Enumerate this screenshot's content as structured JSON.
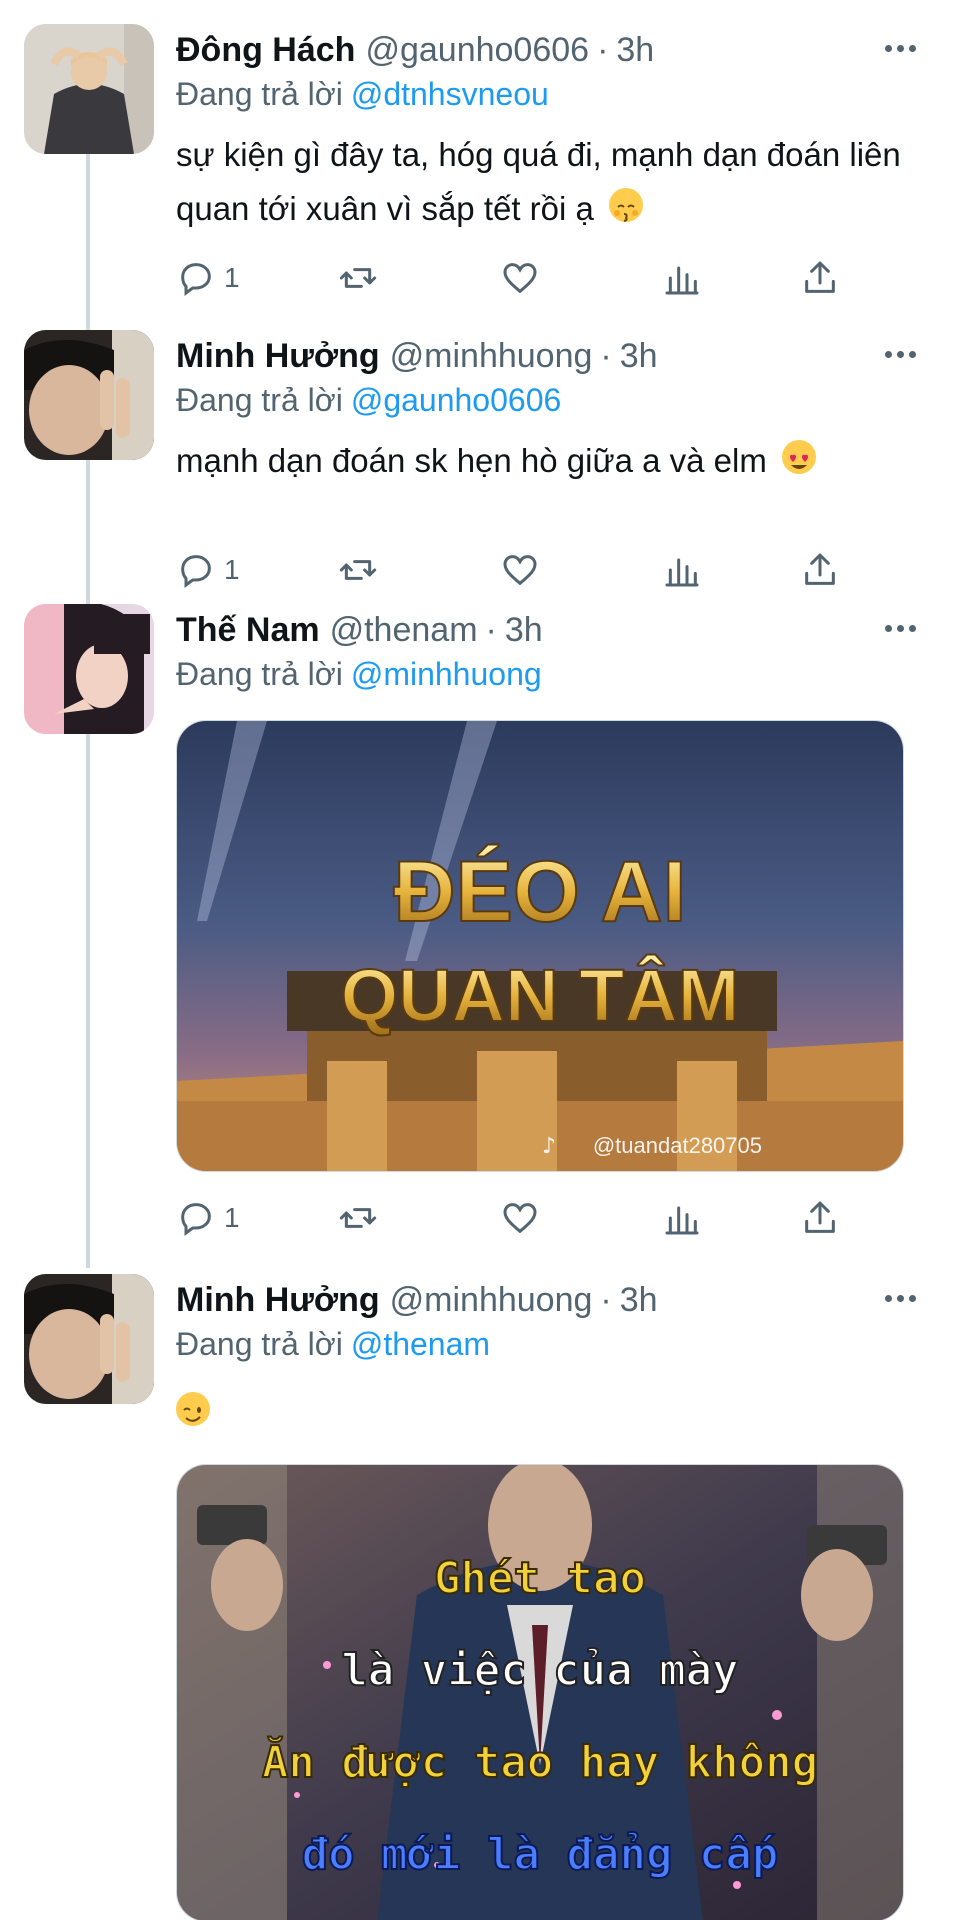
{
  "replying_prefix": "Đang trả lời",
  "tweets": [
    {
      "name": "Đông Hách",
      "handle": "@gaunho0606",
      "time": "3h",
      "reply_to": "@dtnhsvneou",
      "text": "sự kiện gì đây ta, hóg quá đi, mạnh dạn đoán liên quan tới xuân vì sắp tết rồi ạ",
      "emoji": "kissing-face-emoji",
      "reply_count": "1"
    },
    {
      "name": "Minh Hưởng",
      "handle": "@minhhuong",
      "time": "3h",
      "reply_to": "@gaunho0606",
      "text": "mạnh dạn đoán sk hẹn hò giữa a và elm",
      "emoji": "heart-eyes-emoji",
      "reply_count": "1"
    },
    {
      "name": "Thế Nam",
      "handle": "@thenam",
      "time": "3h",
      "reply_to": "@minhhuong",
      "media": {
        "line1": "ĐÉO AI",
        "line2": "QUAN TÂM",
        "watermark": "@tuandat280705"
      },
      "reply_count": "1"
    },
    {
      "name": "Minh Hưởng",
      "handle": "@minhhuong",
      "time": "3h",
      "reply_to": "@thenam",
      "emoji": "winking-face-emoji",
      "media": {
        "lines": [
          "Ghét tao",
          "là việc của mày",
          "Ăn được tao hay không",
          "đó mới là đẳng cấp"
        ]
      }
    }
  ],
  "colors": {
    "link": "#1d9bf0",
    "secondary": "#536471",
    "thread_line": "#cfd9de"
  }
}
